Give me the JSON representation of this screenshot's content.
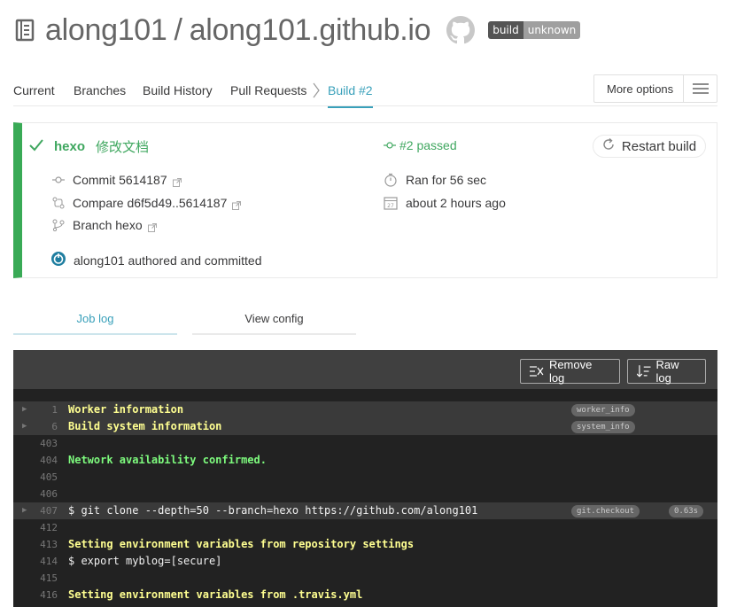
{
  "header": {
    "owner": "along101",
    "separator": "/",
    "repo": "along101.github.io",
    "badge": {
      "left": "build",
      "right": "unknown"
    }
  },
  "nav": {
    "tabs": [
      "Current",
      "Branches",
      "Build History",
      "Pull Requests",
      "Build #2"
    ],
    "active_tab": "Build #2",
    "more_options": "More options"
  },
  "build": {
    "branch": "hexo",
    "message": "修改文档",
    "status": "#2 passed",
    "commit": "Commit 5614187",
    "compare": "Compare d6f5d49..5614187",
    "branch_label": "Branch hexo",
    "author": "along101 authored and committed",
    "duration": "Ran for 56 sec",
    "finished": "about 2 hours ago",
    "restart": "Restart build",
    "status_color": "#39aa56"
  },
  "job_tabs": {
    "log": "Job log",
    "config": "View config"
  },
  "log": {
    "remove_label": "Remove log",
    "raw_label": "Raw log",
    "lines": [
      {
        "num": "1",
        "text": "Worker information",
        "style": "y",
        "fold": true,
        "tag": "worker_info"
      },
      {
        "num": "6",
        "text": "Build system information",
        "style": "y",
        "fold": true,
        "tag": "system_info"
      },
      {
        "num": "403",
        "text": "",
        "style": "",
        "fold": false
      },
      {
        "num": "404",
        "text": "Network availability confirmed.",
        "style": "g",
        "fold": false
      },
      {
        "num": "405",
        "text": "",
        "style": "",
        "fold": false
      },
      {
        "num": "406",
        "text": "",
        "style": "",
        "fold": false
      },
      {
        "num": "407",
        "text": "$ git clone --depth=50 --branch=hexo https://github.com/along101",
        "style": "",
        "fold": true,
        "tag": "git.checkout",
        "time": "0.63s"
      },
      {
        "num": "412",
        "text": "",
        "style": "",
        "fold": false
      },
      {
        "num": "413",
        "text": "Setting environment variables from repository settings",
        "style": "y",
        "fold": false
      },
      {
        "num": "414",
        "text": "$ export myblog=[secure]",
        "style": "",
        "fold": false
      },
      {
        "num": "415",
        "text": "",
        "style": "",
        "fold": false
      },
      {
        "num": "416",
        "text": "Setting environment variables from .travis.yml",
        "style": "y",
        "fold": false
      }
    ]
  }
}
